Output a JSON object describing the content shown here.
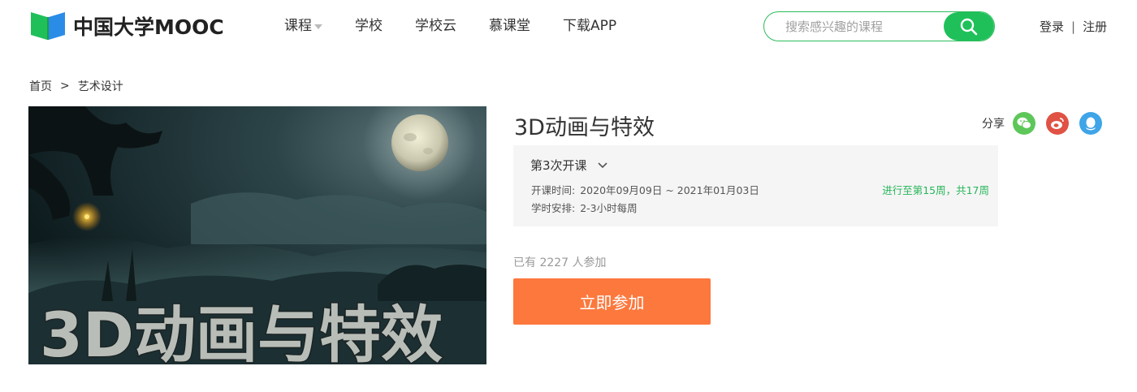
{
  "header": {
    "logo_text": "中国大学MOOC",
    "nav": [
      {
        "label": "课程",
        "has_dropdown": true
      },
      {
        "label": "学校"
      },
      {
        "label": "学校云"
      },
      {
        "label": "慕课堂"
      },
      {
        "label": "下载APP"
      }
    ],
    "search": {
      "placeholder": "搜索感兴趣的课程",
      "value": ""
    },
    "auth": {
      "login": "登录",
      "separator": "|",
      "register": "注册"
    }
  },
  "breadcrumb": {
    "home": "首页",
    "arrow": ">",
    "category": "艺术设计"
  },
  "course": {
    "cover_text": "3D动画与特效",
    "title": "3D动画与特效",
    "share_label": "分享",
    "share_icons": [
      "wechat-icon",
      "weibo-icon",
      "qq-icon"
    ],
    "term": {
      "name": "第3次开课",
      "time_label": "开课时间:",
      "time_value": "2020年09月09日 ~ 2021年01月03日",
      "hours_label": "学时安排:",
      "hours_value": "2-3小时每周",
      "progress": "进行至第15周，共17周"
    },
    "enroll_count": "已有 2227 人参加",
    "enroll_button": "立即参加"
  },
  "colors": {
    "brand_green": "#1fc05a",
    "enroll_orange": "#fd783d",
    "progress_green": "#27b55a"
  }
}
